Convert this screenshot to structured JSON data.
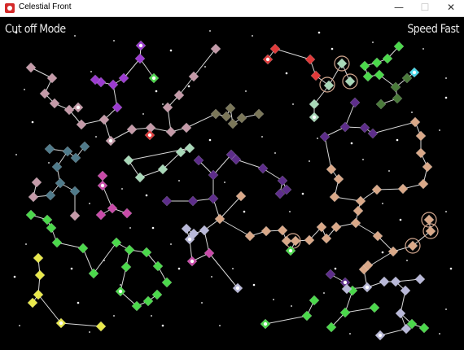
{
  "window": {
    "title": "Celestial Front",
    "minimize": "—",
    "maximize": "☐",
    "close": "✕"
  },
  "hud": {
    "left": "Cut off Mode",
    "right": "Speed Fast"
  },
  "icons": {
    "app": "game-app-icon"
  },
  "colors": {
    "background": "#000000",
    "link": "#d8d8d8",
    "factions": {
      "pink": "#c49aa8",
      "violet": "#9b3bd0",
      "deep_purple": "#5d2d8a",
      "teal": "#4f7a8a",
      "mint": "#a8d8b8",
      "khaki": "#7a7658",
      "red": "#e03a3a",
      "lime": "#4bd84b",
      "peach": "#d9a888",
      "yellow": "#e8e84a",
      "lavender": "#b8b8d8",
      "magenta": "#c84aa8",
      "cyan": "#4ad8e8",
      "olive": "#4a7a3a"
    }
  }
}
